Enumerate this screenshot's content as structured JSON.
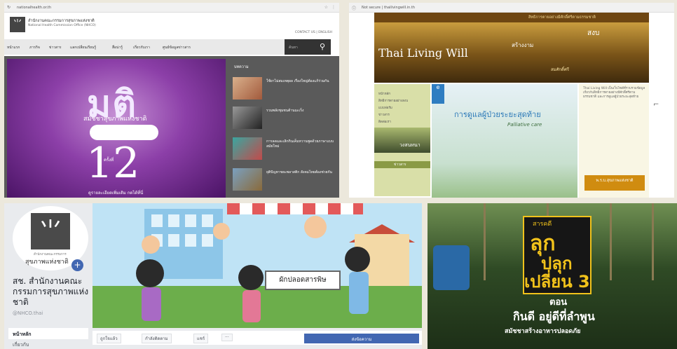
{
  "paneA": {
    "url": "nationalhealth.or.th",
    "org_name_th": "สำนักงานคณะกรรมการสุขภาพแห่งชาติ",
    "org_name_en": "National Health Commission Office (NHCO)",
    "top_links": "CONTACT US | ENGLISH",
    "menu": [
      "หน้าแรก",
      "ภารกิจ",
      "ข่าวสาร",
      "แลกเปลี่ยนเรียนรู้",
      "สื่อน่ารู้",
      "เกี่ยวกับเรา",
      "ศูนย์ข้อมูลข่าวสาร"
    ],
    "search_placeholder": "ค้นหา",
    "banner": {
      "title": "มติ",
      "subtitle": "สมัชชาสุขภาพแห่งชาติ",
      "number": "12",
      "number_label": "ครั้งที่",
      "footer": "ดูรายละเอียดเพิ่มเติม กดได้ที่นี่"
    },
    "news_heading": "บทความ",
    "news": [
      "ใช้ยาไม่สมเหตุผล เรื่องใหญ่ต้องแก้ร่วมกัน",
      "รวมพลังชุมชนต้านมะเร็ง",
      "การลดและเลิกกินเค็มหวานพูดด้วยภาษาแบบสมัยใหม่",
      "ยุติปัญหาขยะพลาสติก สังคมไทยต้องช่วยกัน"
    ]
  },
  "paneB": {
    "url": "Not secure | thailivingwill.in.th",
    "slogan": "สิทธิการตายอย่างมีศักดิ์ศรีตามธรรมชาติ",
    "brand": "Thai Living Will",
    "word1": "สร้างงาม",
    "word2": "สงบ",
    "word3": "สมศักดิ์ศรี",
    "side_menu": [
      "หน้าหลัก",
      "สิทธิการตายอย่างสงบ",
      "แบบฟอร์ม",
      "ข่าวสาร",
      "ติดต่อเรา"
    ],
    "side_button": "วงสนทนา",
    "side_head": "ข่าวสาร",
    "ebook": "e",
    "hero_title": "การดูแลผู้ป่วยระยะสุดท้าย",
    "hero_sub": "Palliative care",
    "right_text": "Thai Living Will เป็นเว็บไซต์ที่รวบรวมข้อมูลเกี่ยวกับสิทธิการตายอย่างมีศักดิ์ศรีตามธรรมชาติ และการดูแลผู้ป่วยระยะสุดท้าย",
    "right_button": "พ.ร.บ.สุขภาพแห่งชาติ"
  },
  "paneC": {
    "avatar_small": "สำนักงานคณะกรรมการ",
    "avatar_label": "สุขภาพแห่งชาติ",
    "page_name": "สช. สำนักงานคณะกรรมการสุขภาพแห่งชาติ",
    "handle": "@NHCO.thai",
    "nav_active": "หน้าหลัก",
    "nav_next": "เกี่ยวกับ",
    "cover_sign": "ผักปลอดสารพิษ",
    "like_button": "ถูกใจแล้ว",
    "follow_button": "กำลังติดตาม",
    "share_button": "แชร์",
    "more_button": "···",
    "message_button": "ส่งข้อความ"
  },
  "paneD": {
    "logo_line1": "สารคดี",
    "logo_line2": "ลุก",
    "logo_line3": "ปลุก",
    "logo_line4": "เปลี่ยน 3",
    "episode_label": "ตอน",
    "episode_title": "กินดี อยู่ดีที่ลำพูน",
    "subtitle": "สมัชชาสร้างอาหารปลอดภัย"
  },
  "colors": {
    "banner_purple": "#8c3fa8",
    "fb_blue": "#4267b2",
    "living_will_gold": "#d08c10",
    "show_yellow": "#f1c21b"
  }
}
